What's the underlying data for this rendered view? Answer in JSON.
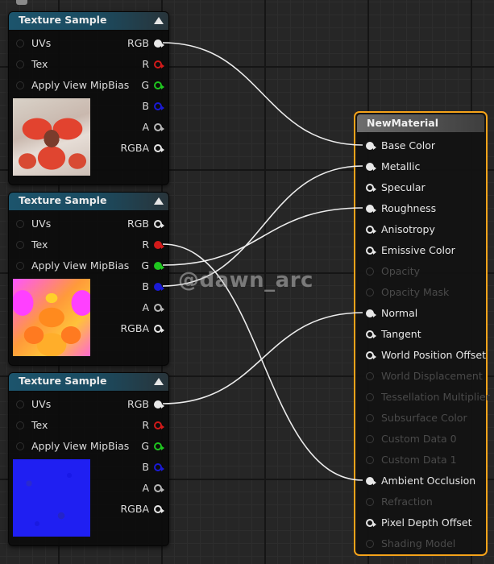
{
  "nodes": [
    {
      "title": "Texture Sample",
      "inputs": [
        {
          "label": "UVs"
        },
        {
          "label": "Tex"
        },
        {
          "label": "Apply View MipBias"
        }
      ],
      "outputs": [
        {
          "label": "RGB",
          "pin_color": "#e8e8e8"
        },
        {
          "label": "R",
          "pin_color": "#d21a1a"
        },
        {
          "label": "G",
          "pin_color": "#1fc61f"
        },
        {
          "label": "B",
          "pin_color": "#1a1ad6"
        },
        {
          "label": "A",
          "pin_color": "#b8b8b8"
        },
        {
          "label": "RGBA",
          "pin_color": "#e8e8e8"
        }
      ],
      "connected_outputs": [
        "RGB"
      ]
    },
    {
      "title": "Texture Sample",
      "inputs": [
        {
          "label": "UVs"
        },
        {
          "label": "Tex"
        },
        {
          "label": "Apply View MipBias"
        }
      ],
      "outputs": [
        {
          "label": "RGB",
          "pin_color": "#e8e8e8"
        },
        {
          "label": "R",
          "pin_color": "#d21a1a"
        },
        {
          "label": "G",
          "pin_color": "#1fc61f"
        },
        {
          "label": "B",
          "pin_color": "#1a1ad6"
        },
        {
          "label": "A",
          "pin_color": "#b8b8b8"
        },
        {
          "label": "RGBA",
          "pin_color": "#e8e8e8"
        }
      ],
      "connected_outputs": [
        "R",
        "G",
        "B"
      ]
    },
    {
      "title": "Texture Sample",
      "inputs": [
        {
          "label": "UVs"
        },
        {
          "label": "Tex"
        },
        {
          "label": "Apply View MipBias"
        }
      ],
      "outputs": [
        {
          "label": "RGB",
          "pin_color": "#e8e8e8"
        },
        {
          "label": "R",
          "pin_color": "#d21a1a"
        },
        {
          "label": "G",
          "pin_color": "#1fc61f"
        },
        {
          "label": "B",
          "pin_color": "#1a1ad6"
        },
        {
          "label": "A",
          "pin_color": "#b8b8b8"
        },
        {
          "label": "RGBA",
          "pin_color": "#e8e8e8"
        }
      ],
      "connected_outputs": [
        "RGB"
      ]
    }
  ],
  "material": {
    "title": "NewMaterial",
    "border_color": "#f5a31a",
    "inputs": [
      {
        "label": "Base Color",
        "enabled": true,
        "connected": true
      },
      {
        "label": "Metallic",
        "enabled": true,
        "connected": true
      },
      {
        "label": "Specular",
        "enabled": true,
        "connected": false
      },
      {
        "label": "Roughness",
        "enabled": true,
        "connected": true
      },
      {
        "label": "Anisotropy",
        "enabled": true,
        "connected": false
      },
      {
        "label": "Emissive Color",
        "enabled": true,
        "connected": false
      },
      {
        "label": "Opacity",
        "enabled": false,
        "connected": false
      },
      {
        "label": "Opacity Mask",
        "enabled": false,
        "connected": false
      },
      {
        "label": "Normal",
        "enabled": true,
        "connected": true
      },
      {
        "label": "Tangent",
        "enabled": true,
        "connected": false
      },
      {
        "label": "World Position Offset",
        "enabled": true,
        "connected": false
      },
      {
        "label": "World Displacement",
        "enabled": false,
        "connected": false
      },
      {
        "label": "Tessellation Multiplier",
        "enabled": false,
        "connected": false
      },
      {
        "label": "Subsurface Color",
        "enabled": false,
        "connected": false
      },
      {
        "label": "Custom Data 0",
        "enabled": false,
        "connected": false
      },
      {
        "label": "Custom Data 1",
        "enabled": false,
        "connected": false
      },
      {
        "label": "Ambient Occlusion",
        "enabled": true,
        "connected": true
      },
      {
        "label": "Refraction",
        "enabled": false,
        "connected": false
      },
      {
        "label": "Pixel Depth Offset",
        "enabled": true,
        "connected": false
      },
      {
        "label": "Shading Model",
        "enabled": false,
        "connected": false
      }
    ]
  },
  "connections": [
    {
      "from_node": 0,
      "from_pin": "RGB",
      "to": "Base Color"
    },
    {
      "from_node": 1,
      "from_pin": "R",
      "to": "Ambient Occlusion"
    },
    {
      "from_node": 1,
      "from_pin": "G",
      "to": "Roughness"
    },
    {
      "from_node": 1,
      "from_pin": "B",
      "to": "Metallic"
    },
    {
      "from_node": 2,
      "from_pin": "RGB",
      "to": "Normal"
    }
  ],
  "watermark": "@dawn_arc"
}
